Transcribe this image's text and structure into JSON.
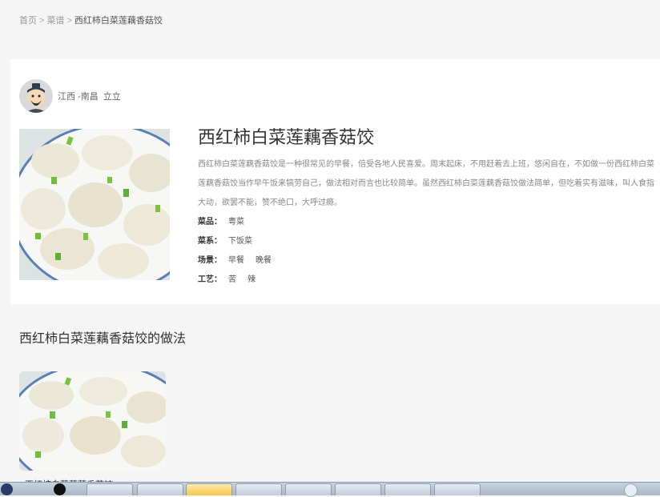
{
  "breadcrumb": {
    "home": "首页",
    "separator": ">",
    "category": "菜谱",
    "current": "西红柿白菜莲藕香菇饺"
  },
  "author": {
    "location": "江西 -南昌",
    "name": "立立"
  },
  "recipe": {
    "title": "西红柿白菜莲藕香菇饺",
    "description": "西红柿白菜莲藕香菇饺是一种很常见的早餐，倍受各地人民喜爱。周末起床，不用赶着去上班，悠闲自在，不如做一份西红柿白菜莲藕香菇饺当作早午饭来犒劳自己，做法相对而言也比较简单。虽然西红柿白菜莲藕香菇饺做法简单，但吃着实有滋味，叫人食指大动，欲罢不能，赞不绝口，大呼过瘾。",
    "attributes": [
      {
        "label": "菜品：",
        "values": [
          "粤菜"
        ]
      },
      {
        "label": "菜系：",
        "values": [
          "下饭菜"
        ]
      },
      {
        "label": "场景：",
        "values": [
          "早餐",
          "晚餐"
        ]
      },
      {
        "label": "工艺：",
        "values": [
          "苦",
          "辣"
        ]
      }
    ]
  },
  "method": {
    "title": "西红柿白菜莲藕香菇饺的做法",
    "step_caption": "西红柿白菜莲藕香菇饺"
  },
  "taskbar": {
    "items": [
      "ie-icon",
      "qq-penguin-icon",
      "app-icon",
      "folder-icon",
      "media-icon",
      "help-icon",
      "firefox-icon",
      "chrome-icon",
      "messenger-icon",
      "files-icon"
    ]
  },
  "colors": {
    "page_bg": "#f5f5f5",
    "card_bg": "#ffffff",
    "text": "#333333",
    "muted": "#888888"
  }
}
